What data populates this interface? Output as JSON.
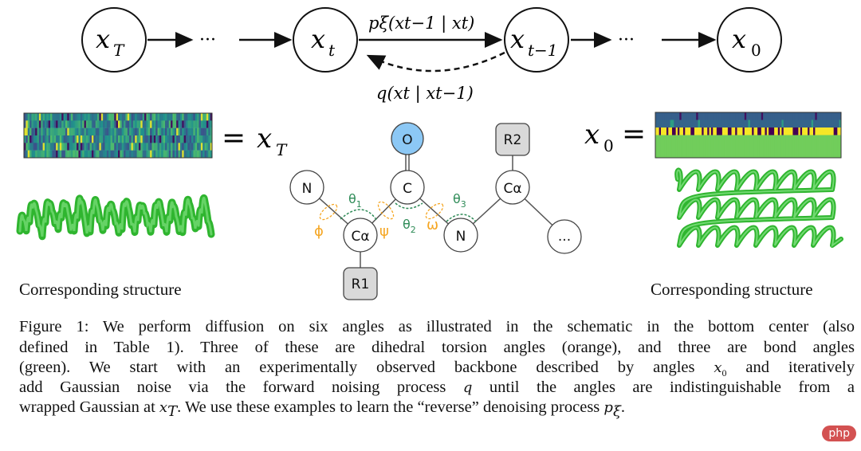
{
  "chain": {
    "nodes": [
      {
        "var": "x",
        "sub": "T"
      },
      {
        "var": "x",
        "sub": "t"
      },
      {
        "var": "x",
        "sub": "t−1"
      },
      {
        "var": "x",
        "sub": "0"
      }
    ],
    "ellipsis": "···",
    "reverse_label": "pξ(xt−1 | xt)",
    "forward_label": "q(xt | xt−1)"
  },
  "left": {
    "equation": "= x_T",
    "eq_text": "=",
    "eq_var": "x",
    "eq_sub": "T",
    "caption": "Corresponding structure"
  },
  "right": {
    "eq_var": "x",
    "eq_sub": "0",
    "eq_text": "=",
    "caption": "Corresponding structure"
  },
  "schematic": {
    "atoms": [
      "N",
      "Cα",
      "C",
      "O",
      "N",
      "Cα",
      "...",
      "R1",
      "R2"
    ],
    "torsion_angles": [
      "ϕ",
      "ψ",
      "ω"
    ],
    "bond_angles": [
      "θ1",
      "θ2",
      "θ3"
    ],
    "colors": {
      "torsion": "#f5a623",
      "bond": "#2e8b57",
      "oxygen": "#8cc8f5",
      "side_chain": "#d9d9d9"
    }
  },
  "caption": {
    "line1": "Figure 1: We perform diffusion on six angles as illustrated in the schematic in the bottom center (also",
    "line2": "defined in Table 1). Three of these are dihedral torsion angles (orange), and three are bond angles",
    "line3a": "(green). We start with an experimentally observed backbone described by angles ",
    "line3b": " and iteratively",
    "line4a": "add Gaussian noise via the forward noising process ",
    "line4b": " until the angles are indistinguishable from a",
    "line5a": "wrapped Gaussian at ",
    "line5b": ". We use these examples to learn the “reverse” denoising process ",
    "line5c": "."
  },
  "watermark": "php"
}
